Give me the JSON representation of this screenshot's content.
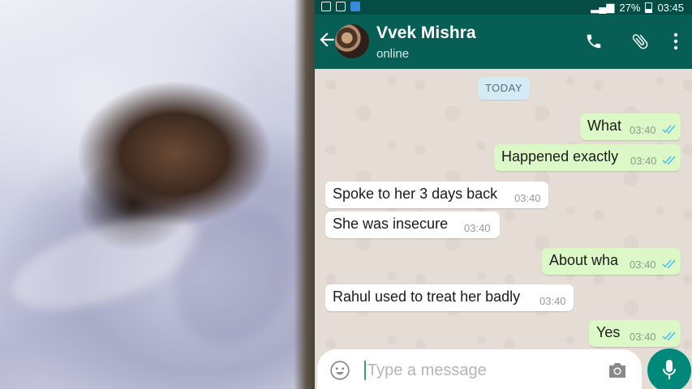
{
  "statusbar": {
    "battery": "27%",
    "time": "03:45"
  },
  "header": {
    "contact_name": "Vvek Mishra",
    "contact_status": "online"
  },
  "chat": {
    "date_chip": "TODAY",
    "messages": [
      {
        "dir": "out",
        "text": "What",
        "time": "03:40"
      },
      {
        "dir": "out",
        "text": "Happened exactly",
        "time": "03:40"
      },
      {
        "dir": "in",
        "text": "Spoke to her 3 days back",
        "time": "03:40"
      },
      {
        "dir": "in",
        "text": "She was insecure",
        "time": "03:40"
      },
      {
        "dir": "out",
        "text": "About wha",
        "time": "03:40"
      },
      {
        "dir": "in",
        "text": "Rahul used to treat her badly",
        "time": "03:40"
      },
      {
        "dir": "out",
        "text": "Yes",
        "time": "03:40"
      }
    ]
  },
  "composer": {
    "placeholder": "Type a message"
  },
  "colors": {
    "appbar": "#075e54",
    "statusbar": "#054d44",
    "outgoing_bubble": "#dcf8c6",
    "incoming_bubble": "#ffffff",
    "mic_button": "#00897b",
    "read_ticks": "#4fc3f7"
  },
  "icons": [
    "back-arrow-icon",
    "call-icon",
    "attach-icon",
    "more-vert-icon",
    "emoji-icon",
    "camera-icon",
    "mic-icon"
  ]
}
